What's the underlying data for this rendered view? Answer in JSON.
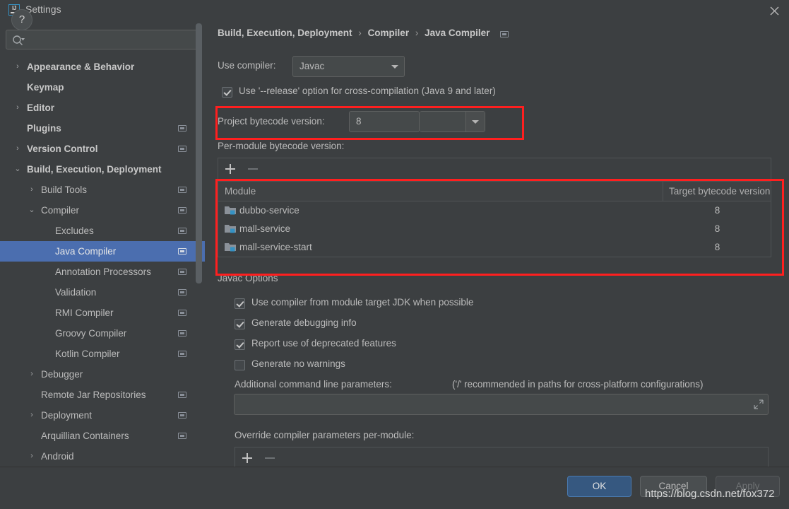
{
  "window": {
    "title": "Settings",
    "logo_text": "IJ",
    "close_icon": "close-icon"
  },
  "search": {
    "value": "",
    "placeholder": "",
    "icon": "search-icon"
  },
  "sidebar": {
    "items": [
      {
        "label": "Appearance & Behavior",
        "indent": 1,
        "arrow": "›",
        "bold": true,
        "badge": false,
        "selected": false
      },
      {
        "label": "Keymap",
        "indent": 1,
        "arrow": "",
        "bold": true,
        "badge": false,
        "selected": false
      },
      {
        "label": "Editor",
        "indent": 1,
        "arrow": "›",
        "bold": true,
        "badge": false,
        "selected": false
      },
      {
        "label": "Plugins",
        "indent": 1,
        "arrow": "",
        "bold": true,
        "badge": true,
        "selected": false
      },
      {
        "label": "Version Control",
        "indent": 1,
        "arrow": "›",
        "bold": true,
        "badge": true,
        "selected": false
      },
      {
        "label": "Build, Execution, Deployment",
        "indent": 1,
        "arrow": "⌄",
        "bold": true,
        "badge": false,
        "selected": false
      },
      {
        "label": "Build Tools",
        "indent": 2,
        "arrow": "›",
        "bold": false,
        "badge": true,
        "selected": false
      },
      {
        "label": "Compiler",
        "indent": 2,
        "arrow": "⌄",
        "bold": false,
        "badge": true,
        "selected": false
      },
      {
        "label": "Excludes",
        "indent": 3,
        "arrow": "",
        "bold": false,
        "badge": true,
        "selected": false
      },
      {
        "label": "Java Compiler",
        "indent": 3,
        "arrow": "",
        "bold": false,
        "badge": true,
        "selected": true
      },
      {
        "label": "Annotation Processors",
        "indent": 3,
        "arrow": "",
        "bold": false,
        "badge": true,
        "selected": false
      },
      {
        "label": "Validation",
        "indent": 3,
        "arrow": "",
        "bold": false,
        "badge": true,
        "selected": false
      },
      {
        "label": "RMI Compiler",
        "indent": 3,
        "arrow": "",
        "bold": false,
        "badge": true,
        "selected": false
      },
      {
        "label": "Groovy Compiler",
        "indent": 3,
        "arrow": "",
        "bold": false,
        "badge": true,
        "selected": false
      },
      {
        "label": "Kotlin Compiler",
        "indent": 3,
        "arrow": "",
        "bold": false,
        "badge": true,
        "selected": false
      },
      {
        "label": "Debugger",
        "indent": 2,
        "arrow": "›",
        "bold": false,
        "badge": false,
        "selected": false
      },
      {
        "label": "Remote Jar Repositories",
        "indent": 2,
        "arrow": "",
        "bold": false,
        "badge": true,
        "selected": false
      },
      {
        "label": "Deployment",
        "indent": 2,
        "arrow": "›",
        "bold": false,
        "badge": true,
        "selected": false
      },
      {
        "label": "Arquillian Containers",
        "indent": 2,
        "arrow": "",
        "bold": false,
        "badge": true,
        "selected": false
      },
      {
        "label": "Android",
        "indent": 2,
        "arrow": "›",
        "bold": false,
        "badge": false,
        "selected": false
      }
    ]
  },
  "breadcrumb": {
    "parts": [
      "Build, Execution, Deployment",
      "Compiler",
      "Java Compiler"
    ],
    "separator": "›",
    "badge_icon": "project-scope-icon"
  },
  "main": {
    "use_compiler_label": "Use compiler:",
    "use_compiler_value": "Javac",
    "release_option": {
      "label": "Use '--release' option for cross-compilation (Java 9 and later)",
      "checked": true
    },
    "project_bytecode_label": "Project bytecode version:",
    "project_bytecode_value": "8",
    "per_module_label": "Per-module bytecode version:",
    "toolbar": {
      "add": "+",
      "remove": "−"
    },
    "table": {
      "columns": [
        "Module",
        "Target bytecode version"
      ],
      "rows": [
        {
          "module": "dubbo-service",
          "target": "8"
        },
        {
          "module": "mall-service",
          "target": "8"
        },
        {
          "module": "mall-service-start",
          "target": "8"
        }
      ]
    },
    "javac_options_title": "Javac Options",
    "checkboxes": [
      {
        "label": "Use compiler from module target JDK when possible",
        "checked": true
      },
      {
        "label": "Generate debugging info",
        "checked": true
      },
      {
        "label": "Report use of deprecated features",
        "checked": true
      },
      {
        "label": "Generate no warnings",
        "checked": false
      }
    ],
    "additional_params_label": "Additional command line parameters:",
    "additional_params_hint": "('/' recommended in paths for cross-platform configurations)",
    "additional_params_value": "",
    "override_label": "Override compiler parameters per-module:"
  },
  "footer": {
    "help": "?",
    "ok": "OK",
    "cancel": "Cancel",
    "apply": "Apply"
  },
  "watermark": "https://blog.csdn.net/fox372",
  "colors": {
    "accent_blue": "#4b6eaf",
    "ok_button": "#365880",
    "annotation_red": "#ff1f1f",
    "background": "#3c3f41"
  }
}
